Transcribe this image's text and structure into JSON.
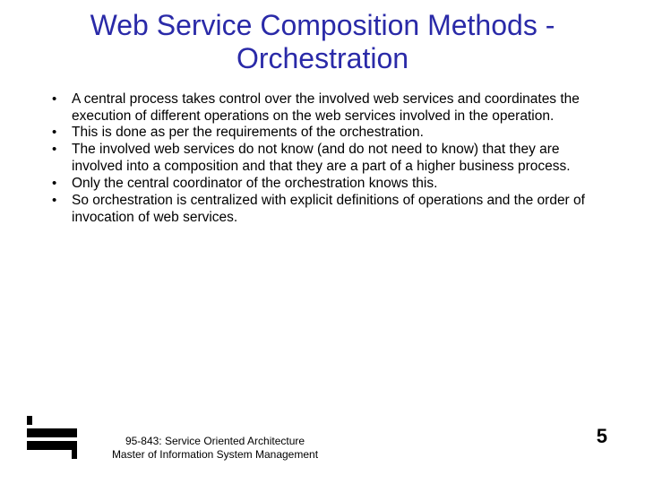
{
  "title": "Web Service Composition Methods - Orchestration",
  "bullets": [
    "A central process takes control over the involved web services and coordinates the execution of different operations on the web services involved in the operation.",
    "This is done as per the requirements of the orchestration.",
    "The involved web services do not know (and do not need to know) that they are involved into a composition and that they are a part of a higher business process.",
    "Only the central coordinator of the orchestration knows this.",
    "So orchestration is centralized with explicit definitions of operations and the order of invocation of web services."
  ],
  "footer": {
    "course": "95-843: Service Oriented Architecture",
    "program": "Master of Information System Management"
  },
  "page_number": "5"
}
